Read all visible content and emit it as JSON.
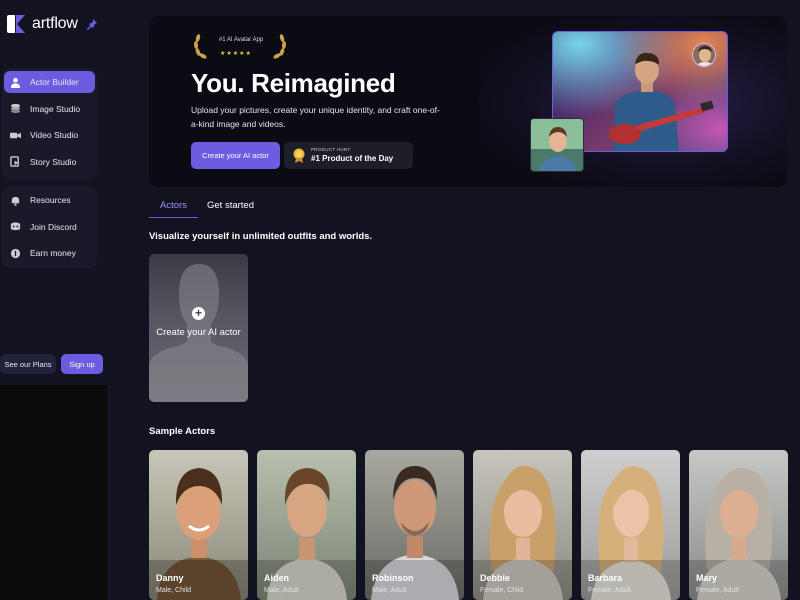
{
  "app": {
    "name": "artflow"
  },
  "sidebar": {
    "group1": [
      {
        "label": "Actor Builder",
        "icon": "person-icon",
        "active": true
      },
      {
        "label": "Image Studio",
        "icon": "layers-icon",
        "active": false
      },
      {
        "label": "Video Studio",
        "icon": "video-camera-icon",
        "active": false
      },
      {
        "label": "Story Studio",
        "icon": "story-icon",
        "active": false
      }
    ],
    "group2": [
      {
        "label": "Resources",
        "icon": "bell-icon"
      },
      {
        "label": "Join Discord",
        "icon": "discord-icon"
      },
      {
        "label": "Earn money",
        "icon": "coin-icon"
      }
    ],
    "plans_label": "See our Plans",
    "signup_label": "Sign up"
  },
  "hero": {
    "badge_text": "#1 AI Avatar App",
    "badge_stars": "★★★★★",
    "title": "You. Reimagined",
    "description": "Upload your pictures, create your unique identity, and craft one-of-a-kind image and videos.",
    "cta_label": "Create your AI actor",
    "product_hunt_small": "PRODUCT HUNT",
    "product_hunt_big": "#1 Product of the Day"
  },
  "tabs": {
    "actors": "Actors",
    "get_started": "Get started"
  },
  "sections": {
    "visualize": "Visualize yourself in unlimited outfits and worlds.",
    "sample_actors": "Sample Actors"
  },
  "create_card": {
    "label": "Create your AI actor"
  },
  "actors": [
    {
      "name": "Danny",
      "meta": "Male, Child"
    },
    {
      "name": "Aiden",
      "meta": "Male, Adult"
    },
    {
      "name": "Robinson",
      "meta": "Male, Adult"
    },
    {
      "name": "Debbie",
      "meta": "Female, Child"
    },
    {
      "name": "Barbara",
      "meta": "Female, Adult"
    },
    {
      "name": "Mary",
      "meta": "Female, Adult"
    }
  ],
  "colors": {
    "accent": "#6b5ce0",
    "background": "#121221",
    "panel": "#19192a"
  }
}
